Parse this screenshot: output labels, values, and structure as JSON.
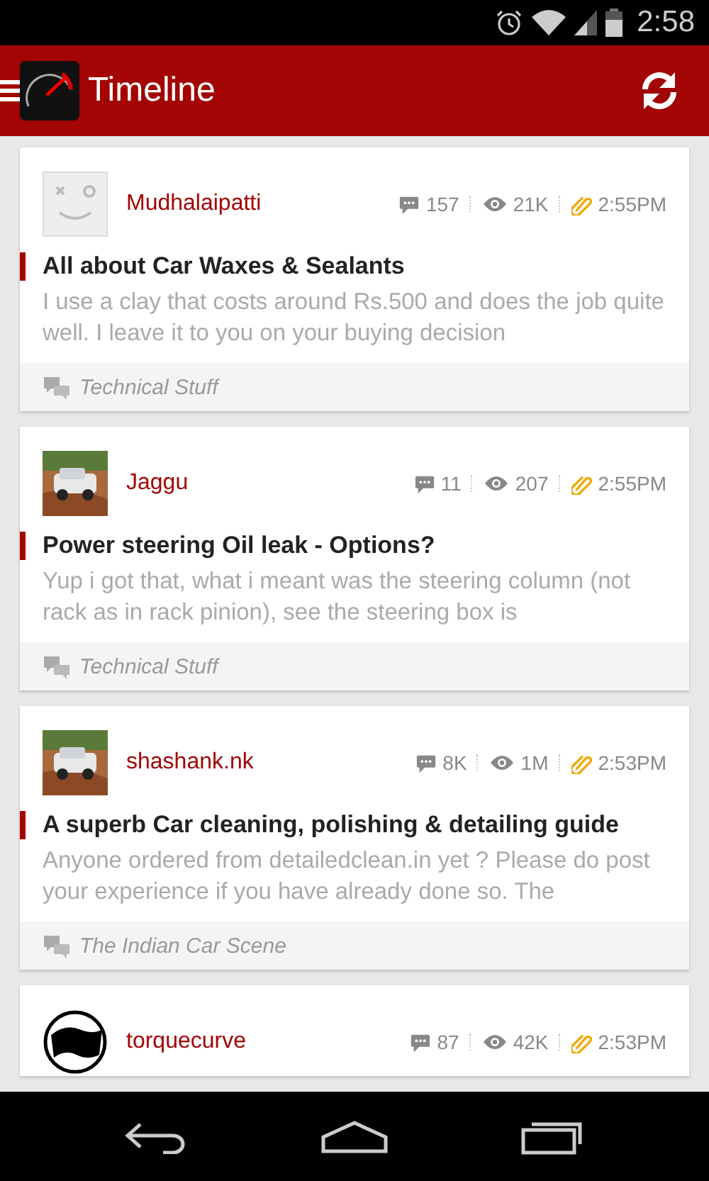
{
  "status_bar": {
    "time": "2:58"
  },
  "app_bar": {
    "title": "Timeline"
  },
  "posts": [
    {
      "author": "Mudhalaipatti",
      "kind": "placeholder",
      "comments": "157",
      "views": "21K",
      "time": "2:55PM",
      "title": "All about Car Waxes & Sealants",
      "excerpt": "I use a clay that costs around Rs.500 and does the job quite well. I leave it to you on your buying decision",
      "category": "Technical Stuff"
    },
    {
      "author": "Jaggu",
      "comments": "11",
      "views": "207",
      "time": "2:55PM",
      "title": "Power steering Oil leak - Options?",
      "excerpt": "Yup i got that, what i meant was the steering column (not rack as in rack pinion), see the steering box is",
      "category": "Technical Stuff"
    },
    {
      "author": "shashank.nk",
      "comments": "8K",
      "views": "1M",
      "time": "2:53PM",
      "title": "A superb Car cleaning, polishing & detailing guide",
      "excerpt": "Anyone ordered from detailedclean.in yet ? Please do post your experience if you have already done so. The",
      "category": "The Indian Car Scene"
    },
    {
      "author": "torquecurve",
      "kind": "logo",
      "comments": "87",
      "views": "42K",
      "time": "2:53PM"
    }
  ]
}
